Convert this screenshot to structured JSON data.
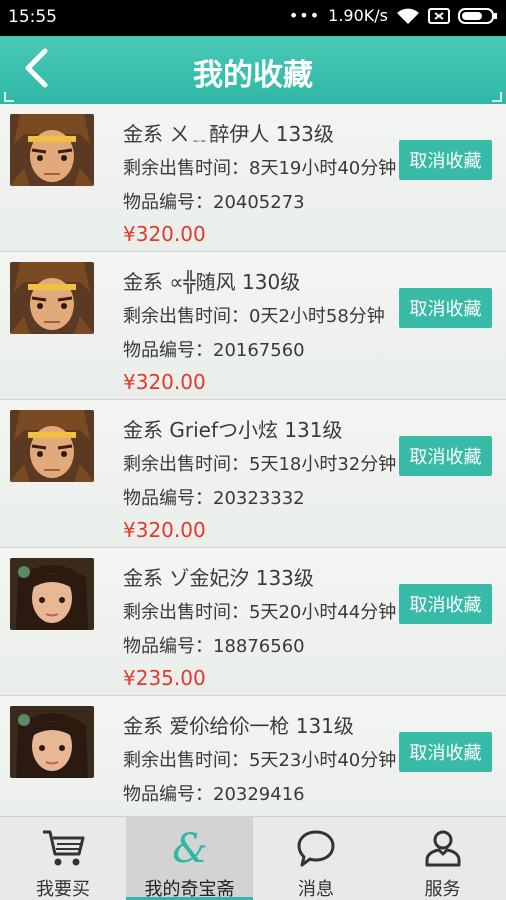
{
  "status_bar": {
    "time": "15:55",
    "network_speed": "1.90K/s"
  },
  "header": {
    "title": "我的收藏",
    "back_icon": "back-arrow-icon"
  },
  "items": [
    {
      "name_line": "金系  ㄨ﹎醉伊人  133级",
      "time_line": "剩余出售时间：8天19小时40分钟",
      "code_line": "物品编号：20405273",
      "price": "¥320.00",
      "cancel_label": "取消收藏",
      "avatar": "male-warrior-avatar"
    },
    {
      "name_line": "金系  ∝╬随风  130级",
      "time_line": "剩余出售时间：0天2小时58分钟",
      "code_line": "物品编号：20167560",
      "price": "¥320.00",
      "cancel_label": "取消收藏",
      "avatar": "male-warrior-avatar"
    },
    {
      "name_line": "金系  Griefつ小炫  131级",
      "time_line": "剩余出售时间：5天18小时32分钟",
      "code_line": "物品编号：20323332",
      "price": "¥320.00",
      "cancel_label": "取消收藏",
      "avatar": "male-warrior-avatar"
    },
    {
      "name_line": "金系  ゾ金妃汐  133级",
      "time_line": "剩余出售时间：5天20小时44分钟",
      "code_line": "物品编号：18876560",
      "price": "¥235.00",
      "cancel_label": "取消收藏",
      "avatar": "female-warrior-avatar"
    },
    {
      "name_line": "金系  爱伱给伱一枪  131级",
      "time_line": "剩余出售时间：5天23小时40分钟",
      "code_line": "物品编号：20329416",
      "price": "",
      "cancel_label": "取消收藏",
      "avatar": "female-warrior-avatar"
    }
  ],
  "nav": [
    {
      "label": "我要买",
      "icon": "shopping-cart-icon",
      "active": false
    },
    {
      "label": "我的奇宝斋",
      "icon": "ampersand-icon",
      "active": true
    },
    {
      "label": "消息",
      "icon": "chat-bubble-icon",
      "active": false
    },
    {
      "label": "服务",
      "icon": "person-icon",
      "active": false
    }
  ],
  "colors": {
    "accent": "#2fb8a6",
    "button": "#38bba6",
    "price": "#e03a2f"
  }
}
